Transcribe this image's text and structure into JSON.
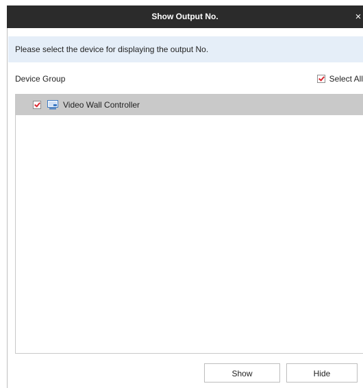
{
  "dialog": {
    "title": "Show Output No.",
    "close_glyph": "×"
  },
  "info": {
    "message": "Please select the device for displaying the output No."
  },
  "group": {
    "label": "Device Group",
    "select_all_label": "Select All",
    "select_all_checked": true
  },
  "tree": {
    "items": [
      {
        "label": "Video Wall Controller",
        "checked": true,
        "icon": "video-wall-controller-icon"
      }
    ]
  },
  "buttons": {
    "show_label": "Show",
    "hide_label": "Hide"
  },
  "colors": {
    "titlebar": "#2b2b2b",
    "info_bar": "#e5eef8",
    "selected_row": "#c9c9c9",
    "check_mark": "#d9282f"
  }
}
